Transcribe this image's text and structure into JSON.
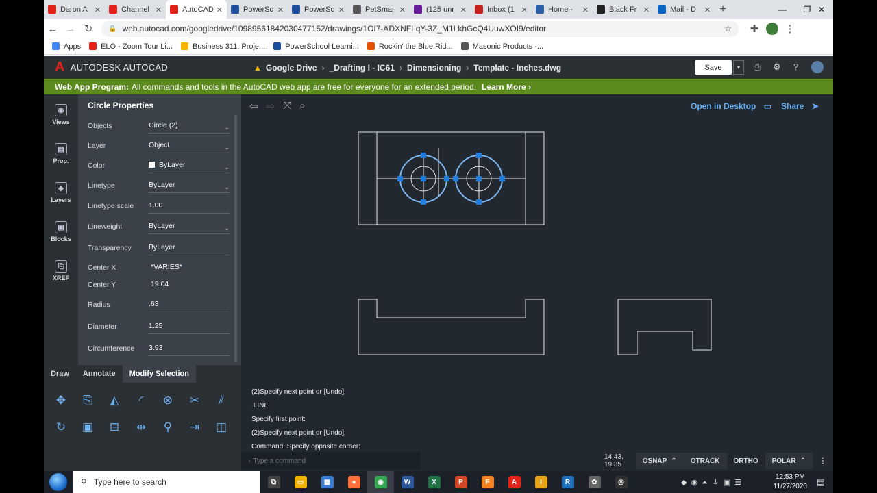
{
  "browser": {
    "tabs": [
      {
        "title": "Daron A",
        "color": "#e62117",
        "icon": "youtube-icon"
      },
      {
        "title": "Channel",
        "color": "#e62117",
        "icon": "youtube-icon"
      },
      {
        "title": "AutoCAD",
        "color": "#e2231a",
        "icon": "autocad-icon"
      },
      {
        "title": "PowerSc",
        "color": "#1c4e9d",
        "icon": "powerschool-icon"
      },
      {
        "title": "PowerSc",
        "color": "#1c4e9d",
        "icon": "powerschool-icon"
      },
      {
        "title": "PetSmar",
        "color": "#555555",
        "icon": "globe-icon"
      },
      {
        "title": "(125 unr",
        "color": "#6a1b9a",
        "icon": "mail-icon"
      },
      {
        "title": "Inbox (1",
        "color": "#c5221f",
        "icon": "gmail-icon"
      },
      {
        "title": "Home -",
        "color": "#2d5fa8",
        "icon": "home-icon"
      },
      {
        "title": "Black Fr",
        "color": "#222222",
        "icon": "amazon-icon"
      },
      {
        "title": "Mail - D",
        "color": "#0a64c4",
        "icon": "outlook-icon"
      }
    ],
    "url": "web.autocad.com/googledrive/1098956184203047715​2/drawings/1OI7-ADXNFLqY-3Z_M1LkhGcQ4UuwXOI9/editor",
    "bookmarks": [
      {
        "label": "Apps",
        "color": "#4285f4"
      },
      {
        "label": "ELO - Zoom Tour Li...",
        "color": "#e62117"
      },
      {
        "label": "Business 311: Proje...",
        "color": "#f4b400"
      },
      {
        "label": "PowerSchool Learni...",
        "color": "#1c4e9d"
      },
      {
        "label": "Rockin' the Blue Rid...",
        "color": "#e65100"
      },
      {
        "label": "Masonic Products -...",
        "color": "#555555"
      }
    ]
  },
  "header": {
    "app_name": "AUTODESK AUTOCAD",
    "crumbs": [
      "Google Drive",
      "_Drafting I - IC61",
      "Dimensioning",
      "Template - Inches.dwg"
    ],
    "save_label": "Save"
  },
  "banner": {
    "bold": "Web App Program:",
    "text": "All commands and tools in the AutoCAD web app are free for everyone for an extended period.",
    "link": "Learn More ›"
  },
  "left_nav": [
    {
      "label": "Views",
      "icon": "eye-icon"
    },
    {
      "label": "Prop.",
      "icon": "properties-icon"
    },
    {
      "label": "Layers",
      "icon": "layers-icon"
    },
    {
      "label": "Blocks",
      "icon": "blocks-icon"
    },
    {
      "label": "XREF",
      "icon": "xref-icon"
    }
  ],
  "properties": {
    "title": "Circle Properties",
    "rows": [
      {
        "label": "Objects",
        "value": "Circle (2)",
        "dropdown": true
      },
      {
        "label": "Layer",
        "value": "Object",
        "dropdown": true
      },
      {
        "label": "Color",
        "value": "ByLayer",
        "dropdown": true,
        "swatch": "#ffffff"
      },
      {
        "label": "Linetype",
        "value": "ByLayer",
        "dropdown": true
      },
      {
        "label": "Linetype scale",
        "value": "1.00"
      },
      {
        "label": "Lineweight",
        "value": "ByLayer",
        "dropdown": true
      },
      {
        "label": "Transparency",
        "value": "ByLayer"
      },
      {
        "label": "Center X",
        "value": "*VARIES*"
      },
      {
        "label": "Center Y",
        "value": "19.04"
      },
      {
        "label": "Radius",
        "value": ".63"
      },
      {
        "label": "Diameter",
        "value": "1.25"
      },
      {
        "label": "Circumference",
        "value": "3.93"
      }
    ]
  },
  "tool_tabs": [
    "Draw",
    "Annotate",
    "Modify Selection"
  ],
  "tools": [
    "move-icon",
    "copy-icon",
    "mirror-icon",
    "fillet-icon",
    "array-icon",
    "trim-icon",
    "offset-icon",
    "rotate-icon",
    "scale-icon",
    "join-icon",
    "break-icon",
    "match-properties-icon",
    "extend-icon",
    "explode-icon"
  ],
  "canvas": {
    "open_desktop": "Open in Desktop",
    "share": "Share",
    "command_history": [
      "(2)Specify next point or [Undo]:",
      ".LINE",
      "Specify first point:",
      "(2)Specify next point or [Undo]:",
      "Command: Specify opposite corner:"
    ],
    "command_placeholder": "Type a command",
    "coords": "14.43, 19.35",
    "status": [
      {
        "label": "OSNAP",
        "on": true,
        "arrow": true
      },
      {
        "label": "OTRACK",
        "on": true,
        "arrow": false
      },
      {
        "label": "ORTHO",
        "on": false,
        "arrow": false
      },
      {
        "label": "POLAR",
        "on": true,
        "arrow": true
      }
    ]
  },
  "taskbar": {
    "search_placeholder": "Type here to search",
    "apps": [
      {
        "name": "task-view-icon",
        "color": "#444444",
        "glyph": "⧉"
      },
      {
        "name": "file-explorer-icon",
        "color": "#f0b400",
        "glyph": "▭"
      },
      {
        "name": "calculator-icon",
        "color": "#3a7bd5",
        "glyph": "▦"
      },
      {
        "name": "firefox-icon",
        "color": "#ff7139",
        "glyph": "●"
      },
      {
        "name": "chrome-icon",
        "color": "#34a853",
        "glyph": "◉"
      },
      {
        "name": "word-icon",
        "color": "#2b579a",
        "glyph": "W"
      },
      {
        "name": "excel-icon",
        "color": "#217346",
        "glyph": "X"
      },
      {
        "name": "powerpoint-icon",
        "color": "#d24726",
        "glyph": "P"
      },
      {
        "name": "fusion-icon",
        "color": "#f58220",
        "glyph": "F"
      },
      {
        "name": "autocad-icon",
        "color": "#e2231a",
        "glyph": "A"
      },
      {
        "name": "inventor-icon",
        "color": "#e8a317",
        "glyph": "I"
      },
      {
        "name": "revit-icon",
        "color": "#1c6fb8",
        "glyph": "R"
      },
      {
        "name": "app-icon",
        "color": "#666666",
        "glyph": "✿"
      },
      {
        "name": "record-icon",
        "color": "#333333",
        "glyph": "◎"
      }
    ],
    "time": "12:53 PM",
    "date": "11/27/2020"
  }
}
